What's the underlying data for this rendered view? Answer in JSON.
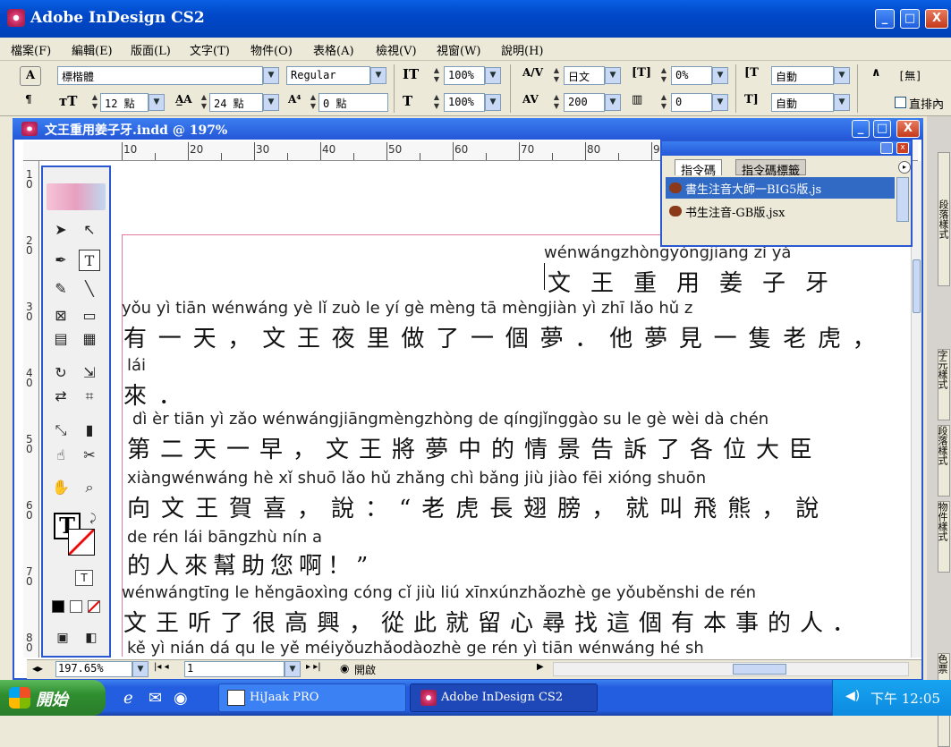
{
  "app": {
    "title": "Adobe InDesign CS2",
    "window_buttons": [
      "_",
      "□",
      "X"
    ]
  },
  "menu": [
    "檔案(F)",
    "編輯(E)",
    "版面(L)",
    "文字(T)",
    "物件(O)",
    "表格(A)",
    "檢視(V)",
    "視窗(W)",
    "說明(H)"
  ],
  "control": {
    "font_family": "標楷體",
    "font_style": "Regular",
    "font_size": "12 點",
    "leading": "24 點",
    "kerning": "0 點",
    "vertical_scale": "100%",
    "horizontal_scale": "100%",
    "tracking_label": "日文",
    "tracking": "200",
    "tsume": "0%",
    "baseline": "0",
    "auto1": "自動",
    "auto2": "自動",
    "none": "[無]",
    "straight_label": "直排內"
  },
  "document": {
    "title": "文王重用姜子牙.indd @ 197%",
    "zoom": "197.65%",
    "page": "1",
    "status": "開啟",
    "ruler_labels": [
      "10",
      "20",
      "30",
      "40",
      "50",
      "60",
      "70",
      "80",
      "90"
    ],
    "vruler_labels": [
      "1\n0",
      "2\n0",
      "3\n0",
      "4\n0",
      "5\n0",
      "6\n0",
      "7\n0",
      "8\n0",
      "9"
    ]
  },
  "text": {
    "title_pinyin": "wénwángzhòngyòngjiāng zǐ yá",
    "title_hanzi": "文王重用姜子牙",
    "lines": [
      {
        "pinyin": "yǒu yì tiān    wénwáng yè  lǐ  zuò  le   yí  gè mèng       tā mèngjiàn yì  zhī lǎo hǔ  z",
        "hanzi": "有一天，文王夜里做了一個夢．他夢見一隻老虎，"
      },
      {
        "pinyin": "lái",
        "hanzi": "來．"
      },
      {
        "pinyin": "dì  èr tiān yì zǎo     wénwángjiāngmèngzhòng de qíngjǐnggào su  le   gè wèi dà chén",
        "hanzi": "第二天一早，文王將夢中的情景告訴了各位大臣"
      },
      {
        "pinyin": "xiàngwénwáng hè  xǐ       shuō         lǎo hǔ zhǎng chì bǎng         jiù jiào fēi xióng   shuōn",
        "hanzi": "向文王賀喜，說：“老虎長翅膀，就叫飛熊，說"
      },
      {
        "pinyin": "de rén lái bāngzhù nín  a",
        "hanzi": "的人來幫助您啊！”"
      },
      {
        "pinyin": "wénwángtīng le hěngāoxìng  cóng cǐ  jiù  liú  xīnxúnzhǎozhè ge yǒuběnshi de rén",
        "hanzi": "文王听了很高興，從此就留心尋找這個有本事的人．"
      },
      {
        "pinyin": "kě  yì nián dá  qu  le      yě méiyǒuzhǎodàozhè ge rén        yì tiān    wénwáng hé sh",
        "hanzi": ""
      }
    ]
  },
  "panel": {
    "tabs": [
      "指令碼",
      "指令碼標籤"
    ],
    "items": [
      "書生注音大師一BIG5版.js",
      "书生注音-GB版.jsx"
    ]
  },
  "side_tabs": [
    "段落樣式",
    "字元樣式",
    "段落樣式",
    "物件樣式",
    "色票",
    "漸層"
  ],
  "taskbar": {
    "start": "開始",
    "items": [
      "HiJaak PRO",
      "Adobe InDesign CS2"
    ],
    "clock": "下午 12:05"
  },
  "colors": {
    "title_blue": "#0048c8",
    "taskbar_blue": "#245ee0",
    "start_green": "#2f8f2f",
    "margin_pink": "#e37aa0"
  }
}
